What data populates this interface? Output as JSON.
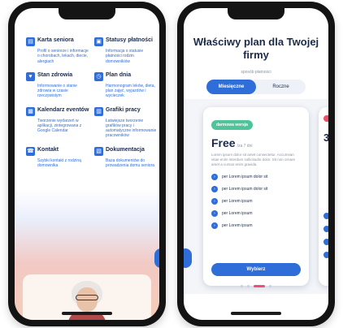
{
  "left_screen": {
    "features": [
      {
        "icon": "senior-card-icon",
        "title": "Karta seniora",
        "desc": "Profil o seniorze i informacje o chorobach, lekach, diecie, alergiach"
      },
      {
        "icon": "status-icon",
        "title": "Statusy płatności",
        "desc": "Informacja o statusie płatności rodzin domownikiów"
      },
      {
        "icon": "health-icon",
        "title": "Stan zdrowia",
        "desc": "Informowanie o stanie zdrowia w czasie rzeczywistym"
      },
      {
        "icon": "day-plan-icon",
        "title": "Plan dnia",
        "desc": "Harmonogram leków, dieta, plan zajęć, wyjazdów i wycieczek"
      },
      {
        "icon": "calendar-icon",
        "title": "Kalendarz eventów",
        "desc": "Tworzenie wydarzeń w aplikacji, zintegrowana z Google Calendar"
      },
      {
        "icon": "schedule-icon",
        "title": "Grafiki pracy",
        "desc": "Łatwiejsze tworzenie grafików pracy i automatyczne informowanie pracowników"
      },
      {
        "icon": "contact-icon",
        "title": "Kontakt",
        "desc": "Szybki kontakt z rodziną domownika"
      },
      {
        "icon": "document-icon",
        "title": "Dokumentacja",
        "desc": "Baza dokumentów do prowadzenia domu seniora"
      }
    ]
  },
  "right_screen": {
    "title": "Właściwy plan dla Twojej firmy",
    "subtitle": "sposób płatności",
    "toggle": {
      "monthly": "Miesięczne",
      "yearly": "Roczne"
    },
    "card": {
      "badge": "darmowa wersja",
      "price": "Free",
      "period": "/za 7 dni",
      "description": "Lorem ipsum dolor sit amet consectetur. Accumsan vitae enim interdum sollicitudin dolor. Sit non ornare amet a cursus enim gravida.",
      "features": [
        "per Lorem ipsum dolor sit",
        "per Lorem ipsum dolor sit",
        "per Lorem ipsum",
        "per Lorem ipsum",
        "per Lorem ipsum"
      ],
      "button": "Wybierz"
    },
    "peek_price": "3"
  },
  "colors": {
    "accent": "#2f6ed8",
    "badge": "#4fc49a",
    "indicator": "#ee4d7f",
    "heading": "#1b2a4a"
  }
}
